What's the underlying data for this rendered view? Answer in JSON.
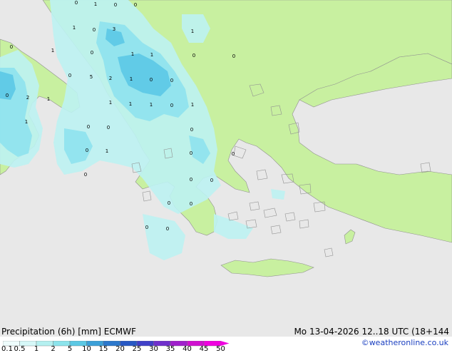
{
  "header": {
    "title": "Precipitation (6h) [mm] ECMWF",
    "datetime": "Mo 13-04-2026 12..18 UTC (18+144",
    "credit": "©weatheronline.co.uk"
  },
  "legend": {
    "ticks": [
      "0.1",
      "0.5",
      "1",
      "2",
      "5",
      "10",
      "15",
      "20",
      "25",
      "30",
      "35",
      "40",
      "45",
      "50"
    ],
    "colors": [
      "#eefcfc",
      "#d6f8f8",
      "#b4f0f0",
      "#8ce4ec",
      "#5cc8e4",
      "#3ca0d8",
      "#2c78cc",
      "#2858c4",
      "#4040c8",
      "#7030cc",
      "#a020cc",
      "#d010d0",
      "#f000e0"
    ]
  },
  "map": {
    "colors": {
      "sea": "#e8e8e8",
      "land": "#c8f0a0",
      "coast": "#909090",
      "precip_light": "#bdf2f2",
      "precip_medium": "#8ee2ee",
      "precip_heavy": "#5cc8e6"
    },
    "value_labels": [
      "0",
      "1",
      "0",
      "0",
      "1",
      "3",
      "1",
      "0",
      "0",
      "1",
      "0",
      "1",
      "1",
      "0",
      "0",
      "0",
      "5",
      "2",
      "1",
      "0",
      "0",
      "0",
      "2",
      "1",
      "1",
      "1",
      "1",
      "0",
      "1",
      "1",
      "0",
      "0",
      "0",
      "0",
      "1",
      "0",
      "0",
      "0",
      "0",
      "0",
      "0",
      "0",
      "0",
      "0"
    ]
  }
}
